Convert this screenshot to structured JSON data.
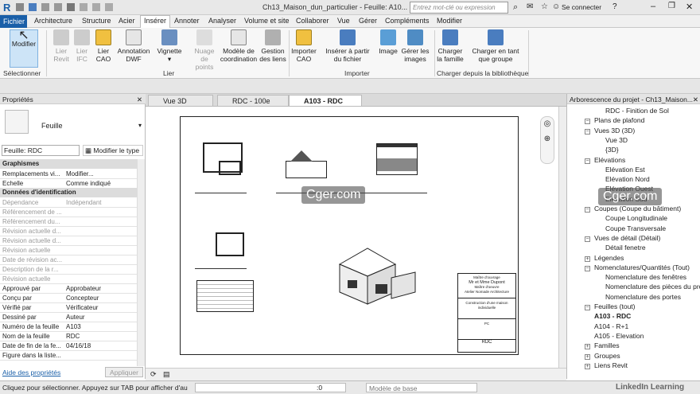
{
  "app": {
    "logo": "R",
    "title": "Ch13_Maison_dun_particulier - Feuille: A10...",
    "search_placeholder": "Entrez mot-clé ou expression",
    "signin": "Se connecter"
  },
  "tabs": [
    "Fichier",
    "Architecture",
    "Structure",
    "Acier",
    "Insérer",
    "Annoter",
    "Analyser",
    "Volume et site",
    "Collaborer",
    "Vue",
    "Gérer",
    "Compléments",
    "Modifier"
  ],
  "ribbon": {
    "modify": "Modifier",
    "select": "Sélectionner",
    "lier_revit": "Lier Revit",
    "lier_ifc": "Lier IFC",
    "lier_cao": "Lier CAO",
    "annotation_dwf": "Annotation DWF",
    "vignette": "Vignette",
    "nuage": "Nuage de points",
    "modele_coord": "Modèle de coordination",
    "gestion_liens": "Gestion des liens",
    "panel_lier": "Lier",
    "importer_cao": "Importer CAO",
    "inserer_fichier": "Insérer à partir du fichier",
    "image": "Image",
    "gerer_images": "Gérer les images",
    "panel_importer": "Importer",
    "charger_famille": "Charger la famille",
    "charger_groupe": "Charger en tant que groupe",
    "panel_biblio": "Charger depuis la bibliothèque"
  },
  "properties": {
    "title": "Propriétés",
    "type": "Feuille",
    "selector": "Feuille: RDC",
    "edit_type": "Modifier le type",
    "help": "Aide des propriétés",
    "apply": "Appliquer",
    "sections": {
      "graphismes": "Graphismes",
      "donnees": "Données d'identification"
    },
    "rows_a": [
      {
        "k": "Remplacements vi...",
        "v": "Modifier..."
      },
      {
        "k": "Echelle",
        "v": "Comme indiqué"
      }
    ],
    "rows_b": [
      {
        "k": "Dépendance",
        "v": "Indépendant"
      },
      {
        "k": "Référencement de ...",
        "v": ""
      },
      {
        "k": "Référencement du...",
        "v": ""
      },
      {
        "k": "Révision actuelle d...",
        "v": ""
      },
      {
        "k": "Révision actuelle d...",
        "v": ""
      },
      {
        "k": "Révision actuelle",
        "v": ""
      },
      {
        "k": "Date de révision ac...",
        "v": ""
      },
      {
        "k": "Description de la r...",
        "v": ""
      },
      {
        "k": "Révision actuelle",
        "v": ""
      },
      {
        "k": "Approuvé par",
        "v": "Approbateur"
      },
      {
        "k": "Conçu par",
        "v": "Concepteur"
      },
      {
        "k": "Vérifié par",
        "v": "Vérificateur"
      },
      {
        "k": "Dessiné par",
        "v": "Auteur"
      },
      {
        "k": "Numéro de la feuille",
        "v": "A103"
      },
      {
        "k": "Nom de la feuille",
        "v": "RDC"
      },
      {
        "k": "Date de fin de la fe...",
        "v": "04/16/18"
      },
      {
        "k": "Figure dans la liste...",
        "v": ""
      }
    ]
  },
  "view_tabs": [
    "Vue 3D",
    "RDC - 100e",
    "A103 - RDC"
  ],
  "sheet": {
    "title": "RDC",
    "tb1": "Maître d'ouvrage",
    "tb2": "Mr et Mme Dupont",
    "tb3": "Maître d'oeuvre",
    "tb4": "Atelier Nomade Architecture",
    "tb5": "Construction d'une maison individuelle",
    "tb6": "PC"
  },
  "browser": {
    "title": "Arborescence du projet - Ch13_Maison...",
    "items": [
      "RDC - Finition de Sol",
      "Plans de plafond",
      "Vues 3D (3D)",
      "Vue 3D",
      "{3D}",
      "Elévations",
      "Elévation Est",
      "Elévation Nord",
      "Elévation Ouest",
      "Elévation Sud",
      "Coupes (Coupe du bâtiment)",
      "Coupe Longitudinale",
      "Coupe Transversale",
      "Vues de détail (Détail)",
      "Détail fenetre",
      "Légendes",
      "Nomenclatures/Quantités (Tout)",
      "Nomenclature des fenêtres",
      "Nomenclature des pièces du projet",
      "Nomenclature des portes",
      "Feuilles (tout)",
      "A103 - RDC",
      "A104 - R+1",
      "A105 - Elevation",
      "Familles",
      "Groupes",
      "Liens Revit"
    ]
  },
  "status": {
    "text": "Cliquez pour sélectionner. Appuyez sur TAB pour afficher d'au",
    "zero": ":0",
    "model": "Modèle de base"
  },
  "watermark": "Cger.com",
  "linkedin": "LinkedIn Learning"
}
